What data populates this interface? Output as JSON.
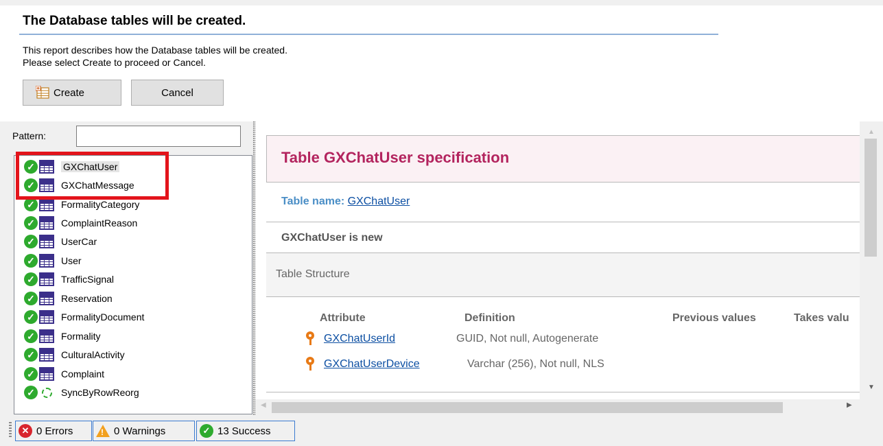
{
  "header": {
    "title": "The Database tables will be created.",
    "description_line1": "This report describes how the Database tables will be created.",
    "description_line2": "Please select Create to proceed or Cancel."
  },
  "buttons": {
    "create_label": "Create",
    "cancel_label": "Cancel"
  },
  "filter": {
    "pattern_label": "Pattern:",
    "pattern_value": ""
  },
  "tables": [
    {
      "name": "GXChatUser",
      "icon": "table-icon",
      "status": "success",
      "selected": true
    },
    {
      "name": "GXChatMessage",
      "icon": "table-icon",
      "status": "success"
    },
    {
      "name": "FormalityCategory",
      "icon": "table-icon",
      "status": "success"
    },
    {
      "name": "ComplaintReason",
      "icon": "table-icon",
      "status": "success"
    },
    {
      "name": "UserCar",
      "icon": "table-icon",
      "status": "success"
    },
    {
      "name": "User",
      "icon": "table-icon",
      "status": "success"
    },
    {
      "name": "TrafficSignal",
      "icon": "table-icon",
      "status": "success"
    },
    {
      "name": "Reservation",
      "icon": "table-icon",
      "status": "success"
    },
    {
      "name": "FormalityDocument",
      "icon": "table-icon",
      "status": "success"
    },
    {
      "name": "Formality",
      "icon": "table-icon",
      "status": "success"
    },
    {
      "name": "CulturalActivity",
      "icon": "table-icon",
      "status": "success"
    },
    {
      "name": "Complaint",
      "icon": "table-icon",
      "status": "success"
    },
    {
      "name": "SyncByRowReorg",
      "icon": "sync-icon",
      "status": "success"
    }
  ],
  "report": {
    "spec_title": "Table GXChatUser specification",
    "table_name_label": "Table name: ",
    "table_name_link": "GXChatUser",
    "is_new_text": "GXChatUser is new",
    "structure_heading": "Table Structure",
    "columns": [
      "Attribute",
      "Definition",
      "Previous values",
      "Takes valu"
    ],
    "attributes": [
      {
        "name": "GXChatUserId",
        "definition": "GUID, Not null, Autogenerate",
        "key": true
      },
      {
        "name": "GXChatUserDevice",
        "definition": "Varchar (256), Not null, NLS",
        "key": true
      }
    ]
  },
  "status": {
    "errors": "0 Errors",
    "warnings": "0 Warnings",
    "success": "13 Success"
  },
  "colors": {
    "spec_title": "#b3245e",
    "highlight": "#e3141b",
    "success": "#2eaa2e",
    "error": "#d8252d",
    "warning": "#f2a01e",
    "link": "#0b4ea2"
  }
}
